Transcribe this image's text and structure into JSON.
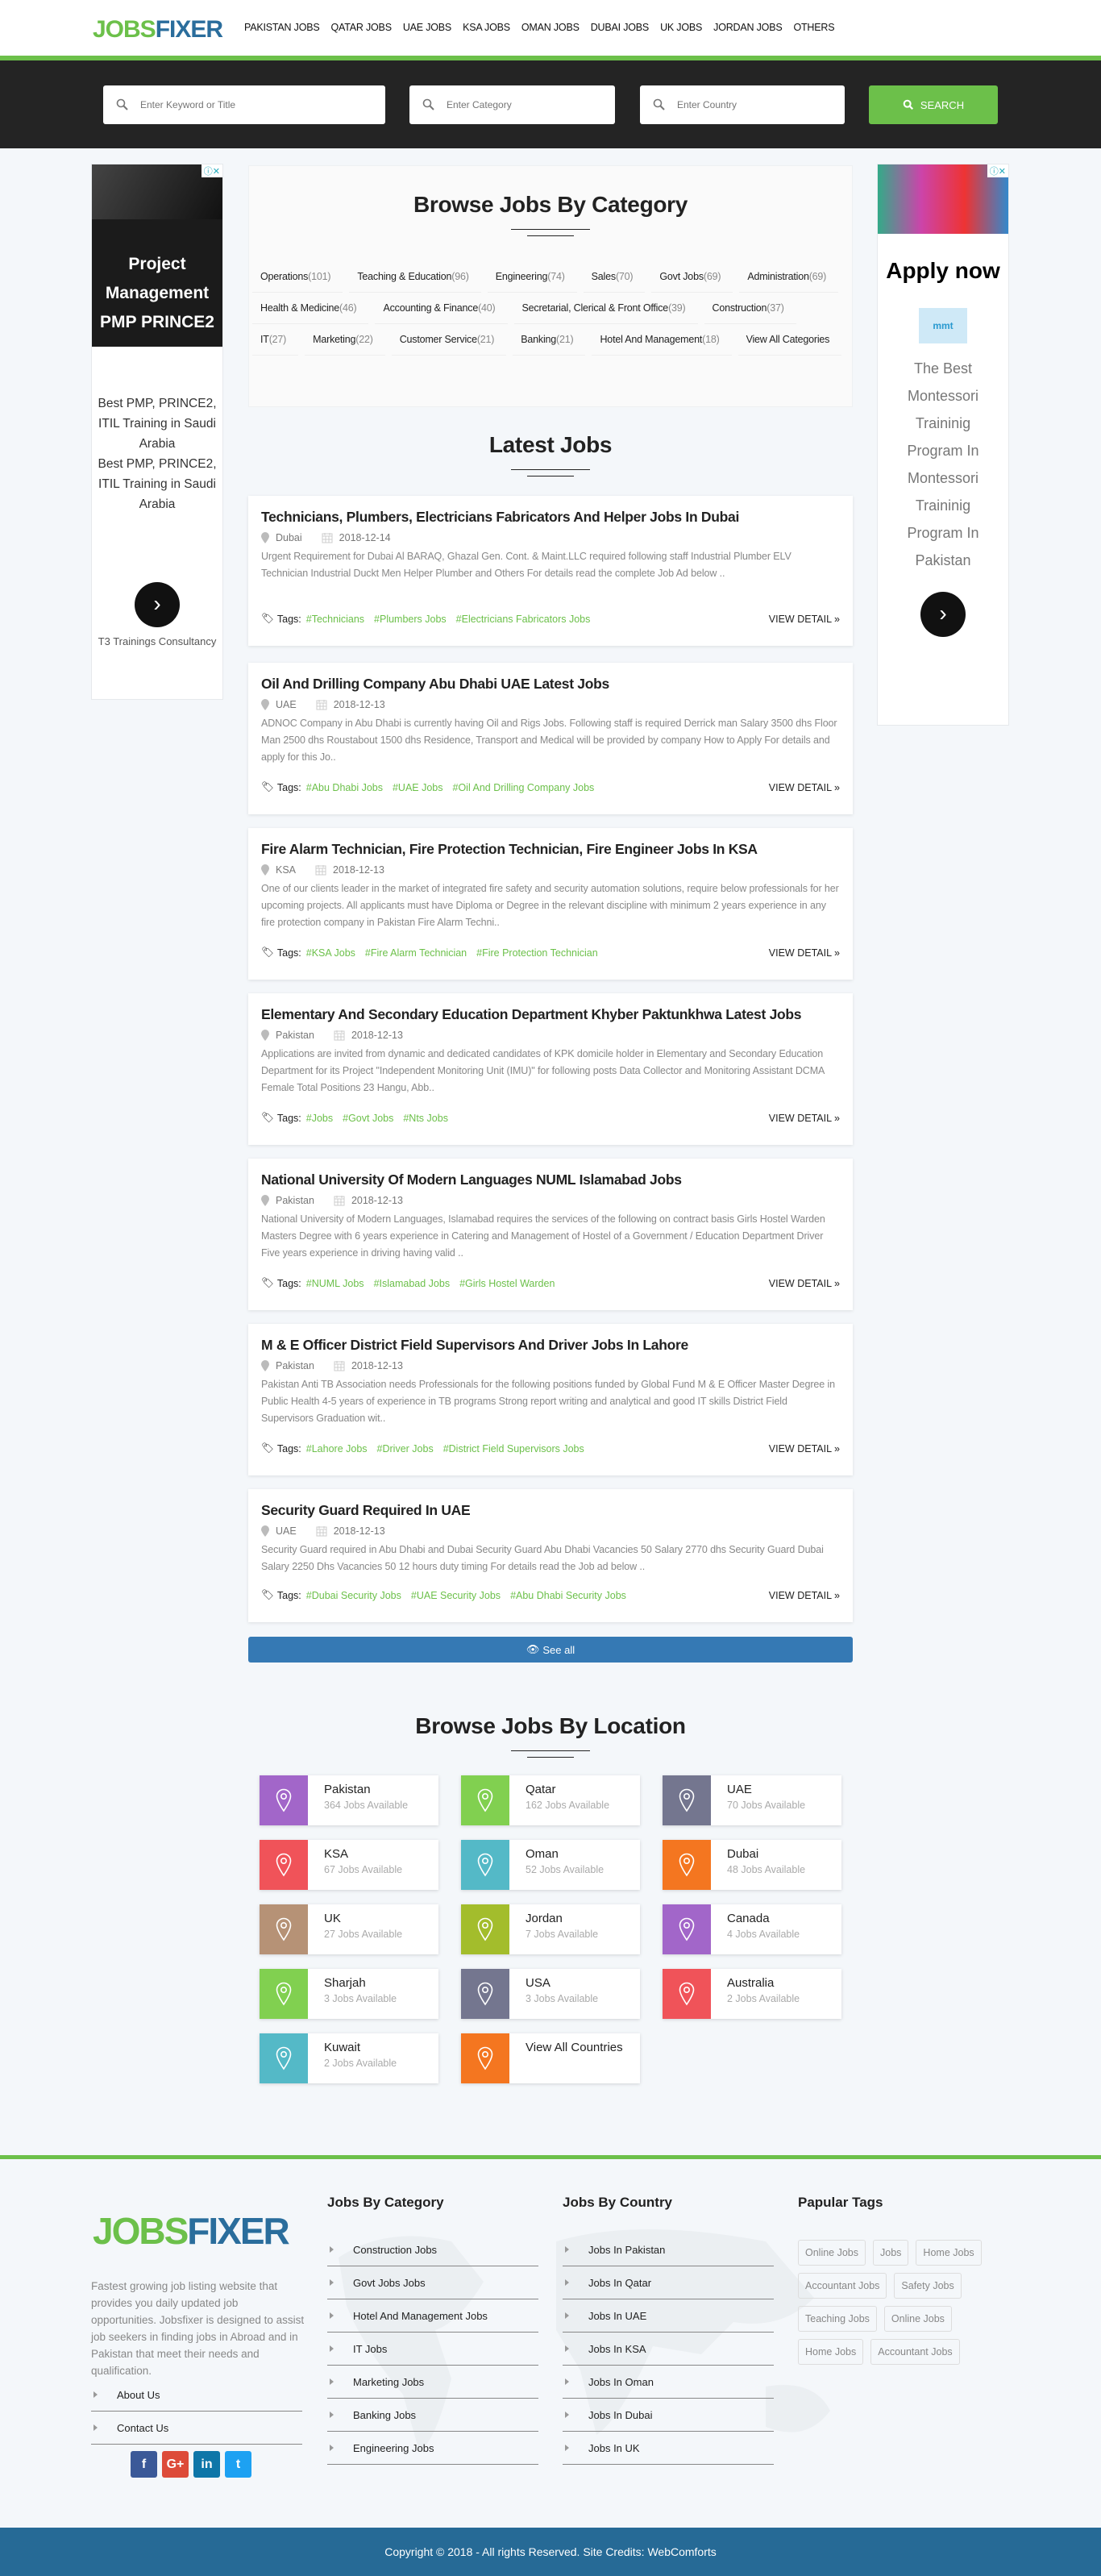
{
  "brand": {
    "logo_part1": "JOBS",
    "logo_part2": "FIXER",
    "accent": "#6cc04a",
    "blue": "#2a6d9c"
  },
  "nav": [
    "PAKISTAN JOBS",
    "QATAR JOBS",
    "UAE JOBS",
    "KSA JOBS",
    "OMAN JOBS",
    "DUBAI JOBS",
    "UK JOBS",
    "JORDAN JOBS",
    "OTHERS"
  ],
  "search": {
    "keyword_placeholder": "Enter Keyword or Title",
    "category_placeholder": "Enter Category",
    "country_placeholder": "Enter Country",
    "button": "SEARCH"
  },
  "ad_left": {
    "headline": "Project Management PMP PRINCE2",
    "text1": "Best PMP, PRINCE2, ITIL Training in Saudi Arabia",
    "text2": "Best PMP, PRINCE2, ITIL Training in Saudi Arabia",
    "advertiser": "T3 Trainings Consultancy"
  },
  "ad_right": {
    "headline": "Apply now",
    "logo": "mmt",
    "text": "The Best Montessori Traininig Program In Montessori Traininig Program In Pakistan"
  },
  "categories": {
    "title": "Browse Jobs By Category",
    "items": [
      {
        "name": "Operations",
        "count": "(101)"
      },
      {
        "name": "Teaching & Education",
        "count": "(96)"
      },
      {
        "name": "Engineering",
        "count": "(74)"
      },
      {
        "name": "Sales",
        "count": "(70)"
      },
      {
        "name": "Govt Jobs",
        "count": "(69)"
      },
      {
        "name": "Administration",
        "count": "(69)"
      },
      {
        "name": "Health & Medicine",
        "count": "(46)"
      },
      {
        "name": "Accounting & Finance",
        "count": "(40)"
      },
      {
        "name": "Secretarial, Clerical & Front Office",
        "count": "(39)"
      },
      {
        "name": "Construction",
        "count": "(37)"
      },
      {
        "name": "IT",
        "count": "(27)"
      },
      {
        "name": "Marketing",
        "count": "(22)"
      },
      {
        "name": "Customer Service",
        "count": "(21)"
      },
      {
        "name": "Banking",
        "count": "(21)"
      },
      {
        "name": "Hotel And Management",
        "count": "(18)"
      },
      {
        "name": "View All Categories",
        "count": ""
      }
    ]
  },
  "latest": {
    "title": "Latest Jobs",
    "tags_label": "Tags:",
    "view_detail": "VIEW DETAIL »",
    "see_all": "See all",
    "jobs": [
      {
        "title": "Technicians, Plumbers, Electricians Fabricators And Helper Jobs In Dubai",
        "location": "Dubai",
        "date": "2018-12-14",
        "desc": "Urgent Requirement for Dubai Al BARAQ, Ghazal Gen. Cont. & Maint.LLC required following staff Industrial Plumber ELV Technician Industrial Duckt Men Helper Plumber and Others For details read the complete Job Ad below ..",
        "tags": [
          "#Technicians",
          "#Plumbers Jobs",
          "#Electricians Fabricators Jobs"
        ]
      },
      {
        "title": "Oil And Drilling Company Abu Dhabi UAE Latest Jobs",
        "location": "UAE",
        "date": "2018-12-13",
        "desc": "ADNOC Company in Abu Dhabi is currently having Oil and Rigs Jobs. Following staff is required Derrick man Salary 3500 dhs Floor Man 2500 dhs Roustabout 1500 dhs Residence, Transport and Medical will be provided by company How to Apply For details and apply for this Jo..",
        "tags": [
          "#Abu Dhabi Jobs",
          "#UAE Jobs",
          "#Oil And Drilling Company Jobs"
        ]
      },
      {
        "title": "Fire Alarm Technician, Fire Protection Technician, Fire Engineer Jobs In KSA",
        "location": "KSA",
        "date": "2018-12-13",
        "desc": "One of our clients leader in the market of integrated fire safety and security automation solutions, require below professionals for her upcoming projects. All applicants must have Diploma or Degree in the relevant discipline with minimum 2 years experience in any fire protection company in Pakistan Fire Alarm Techni..",
        "tags": [
          "#KSA Jobs",
          "#Fire Alarm Technician",
          "#Fire Protection Technician"
        ]
      },
      {
        "title": "Elementary And Secondary Education Department Khyber Paktunkhwa Latest Jobs",
        "location": "Pakistan",
        "date": "2018-12-13",
        "desc": "Applications are invited from dynamic and dedicated candidates of KPK domicile holder in Elementary and Secondary Education Department for its Project \"Independent Monitoring Unit (IMU)\" for following posts Data Collector and Monitoring Assistant DCMA Female Total Positions 23 Hangu, Abb..",
        "tags": [
          "#Jobs",
          "#Govt Jobs",
          "#Nts Jobs"
        ]
      },
      {
        "title": "National University Of Modern Languages NUML Islamabad Jobs",
        "location": "Pakistan",
        "date": "2018-12-13",
        "desc": "National University of Modern Languages, Islamabad requires the services of the following on contract basis Girls Hostel Warden Masters Degree with 6 years experience in Catering and Management of Hostel of a Government / Education Department Driver Five years experience in driving having valid ..",
        "tags": [
          "#NUML Jobs",
          "#Islamabad Jobs",
          "#Girls Hostel Warden"
        ]
      },
      {
        "title": "M & E Officer District Field Supervisors And Driver Jobs In Lahore",
        "location": "Pakistan",
        "date": "2018-12-13",
        "desc": "Pakistan Anti TB Association needs Professionals for the following positions funded by Global Fund M & E Officer Master Degree in Public Health 4-5 years of experience in TB programs Strong report writing and analytical and good IT skills District Field Supervisors Graduation wit..",
        "tags": [
          "#Lahore Jobs",
          "#Driver Jobs",
          "#District Field Supervisors Jobs"
        ]
      },
      {
        "title": "Security Guard Required In UAE",
        "location": "UAE",
        "date": "2018-12-13",
        "desc": "Security Guard required in Abu Dhabi and Dubai Security Guard Abu Dhabi Vacancies 50 Salary 2770 dhs Security Guard Dubai Salary 2250 Dhs Vacancies 50 12 hours duty timing For details read the Job ad below  ..",
        "tags": [
          "#Dubai Security Jobs",
          "#UAE Security Jobs",
          "#Abu Dhabi Security Jobs"
        ]
      }
    ]
  },
  "locations": {
    "title": "Browse Jobs By Location",
    "items": [
      {
        "name": "Pakistan",
        "count": "364 Jobs Available",
        "color": "#a266c9"
      },
      {
        "name": "Qatar",
        "count": "162 Jobs Available",
        "color": "#81d050"
      },
      {
        "name": "UAE",
        "count": "70 Jobs Available",
        "color": "#74768f"
      },
      {
        "name": "KSA",
        "count": "67 Jobs Available",
        "color": "#f05359"
      },
      {
        "name": "Oman",
        "count": "52 Jobs Available",
        "color": "#54b9c7"
      },
      {
        "name": "Dubai",
        "count": "48 Jobs Available",
        "color": "#f47620"
      },
      {
        "name": "UK",
        "count": "27 Jobs Available",
        "color": "#b69276"
      },
      {
        "name": "Jordan",
        "count": "7 Jobs Available",
        "color": "#a3bd2c"
      },
      {
        "name": "Canada",
        "count": "4 Jobs Available",
        "color": "#a266c9"
      },
      {
        "name": "Sharjah",
        "count": "3 Jobs Available",
        "color": "#81d050"
      },
      {
        "name": "USA",
        "count": "3 Jobs Available",
        "color": "#74768f"
      },
      {
        "name": "Australia",
        "count": "2 Jobs Available",
        "color": "#f05359"
      },
      {
        "name": "Kuwait",
        "count": "2 Jobs Available",
        "color": "#54b9c7"
      },
      {
        "name": "View All Countries",
        "count": "",
        "color": "#f47620"
      }
    ]
  },
  "footer": {
    "about": "Fastest growing job listing website that provides you daily updated job opportunities. Jobsfixer is designed to assist job seekers in finding jobs in Abroad and in Pakistan that meet their needs and qualification.",
    "links": [
      "About Us",
      "Contact Us"
    ],
    "category_heading": "Jobs By Category",
    "category_links": [
      "Construction Jobs",
      "Govt Jobs Jobs",
      "Hotel And Management Jobs",
      "IT Jobs",
      "Marketing Jobs",
      "Banking Jobs",
      "Engineering Jobs"
    ],
    "country_heading": "Jobs By Country",
    "country_links": [
      "Jobs In Pakistan",
      "Jobs In Qatar",
      "Jobs In UAE",
      "Jobs In KSA",
      "Jobs In Oman",
      "Jobs In Dubai",
      "Jobs In UK"
    ],
    "tags_heading": "Papular Tags",
    "tags": [
      "Online Jobs",
      "Jobs",
      "Home Jobs",
      "Accountant Jobs",
      "Safety Jobs",
      "Teaching Jobs",
      "Online Jobs",
      "Home Jobs",
      "Accountant Jobs"
    ],
    "social": [
      {
        "icon": "facebook-icon",
        "glyph": "f",
        "color": "#3b5998"
      },
      {
        "icon": "google-plus-icon",
        "glyph": "G+",
        "color": "#dd4b39"
      },
      {
        "icon": "linkedin-icon",
        "glyph": "in",
        "color": "#0e76a8"
      },
      {
        "icon": "twitter-icon",
        "glyph": "t",
        "color": "#1da1f2"
      }
    ],
    "copyright": "Copyright © 2018 - All rights Reserved. Site Credits: WebComforts"
  }
}
